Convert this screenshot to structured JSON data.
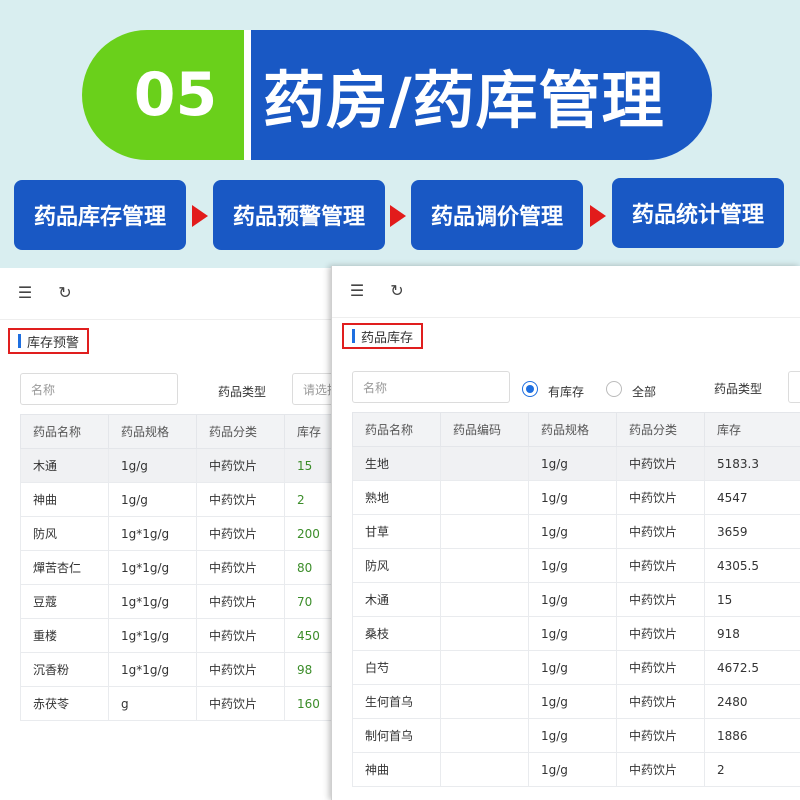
{
  "banner": {
    "number": "05",
    "title": "药房/药库管理"
  },
  "flow": {
    "steps": [
      "药品库存管理",
      "药品预警管理",
      "药品调价管理",
      "药品统计管理"
    ]
  },
  "left_panel": {
    "toolbar": {
      "menu_icon": "menu-fold-icon",
      "refresh_icon": "refresh-icon"
    },
    "breadcrumb": "库存预警",
    "filters": {
      "name_placeholder": "名称",
      "type_label": "药品类型",
      "type_placeholder": "请选择"
    },
    "table": {
      "headers": [
        "药品名称",
        "药品规格",
        "药品分类",
        "库存"
      ],
      "rows": [
        [
          "木通",
          "1g/g",
          "中药饮片",
          "15"
        ],
        [
          "神曲",
          "1g/g",
          "中药饮片",
          "2"
        ],
        [
          "防风",
          "1g*1g/g",
          "中药饮片",
          "200"
        ],
        [
          "燀苦杏仁",
          "1g*1g/g",
          "中药饮片",
          "80"
        ],
        [
          "豆蔻",
          "1g*1g/g",
          "中药饮片",
          "70"
        ],
        [
          "重楼",
          "1g*1g/g",
          "中药饮片",
          "450"
        ],
        [
          "沉香粉",
          "1g*1g/g",
          "中药饮片",
          "98"
        ],
        [
          "赤茯苓",
          "g",
          "中药饮片",
          "160"
        ]
      ]
    }
  },
  "right_panel": {
    "toolbar": {
      "menu_icon": "menu-fold-icon",
      "refresh_icon": "refresh-icon"
    },
    "breadcrumb": "药品库存",
    "filters": {
      "name_placeholder": "名称",
      "radio_in_stock": "有库存",
      "radio_all": "全部",
      "type_label": "药品类型"
    },
    "table": {
      "headers": [
        "药品名称",
        "药品编码",
        "药品规格",
        "药品分类",
        "库存"
      ],
      "rows": [
        [
          "生地",
          "",
          "1g/g",
          "中药饮片",
          "5183.3"
        ],
        [
          "熟地",
          "",
          "1g/g",
          "中药饮片",
          "4547"
        ],
        [
          "甘草",
          "",
          "1g/g",
          "中药饮片",
          "3659"
        ],
        [
          "防风",
          "",
          "1g/g",
          "中药饮片",
          "4305.5"
        ],
        [
          "木通",
          "",
          "1g/g",
          "中药饮片",
          "15"
        ],
        [
          "桑枝",
          "",
          "1g/g",
          "中药饮片",
          "918"
        ],
        [
          "白芍",
          "",
          "1g/g",
          "中药饮片",
          "4672.5"
        ],
        [
          "生何首乌",
          "",
          "1g/g",
          "中药饮片",
          "2480"
        ],
        [
          "制何首乌",
          "",
          "1g/g",
          "中药饮片",
          "1886"
        ],
        [
          "神曲",
          "",
          "1g/g",
          "中药饮片",
          "2"
        ]
      ]
    }
  },
  "colors": {
    "green": "#6ad01b",
    "blue": "#1958c4",
    "arrow_red": "#e21b1b",
    "stock_green": "#3c8d2a"
  }
}
